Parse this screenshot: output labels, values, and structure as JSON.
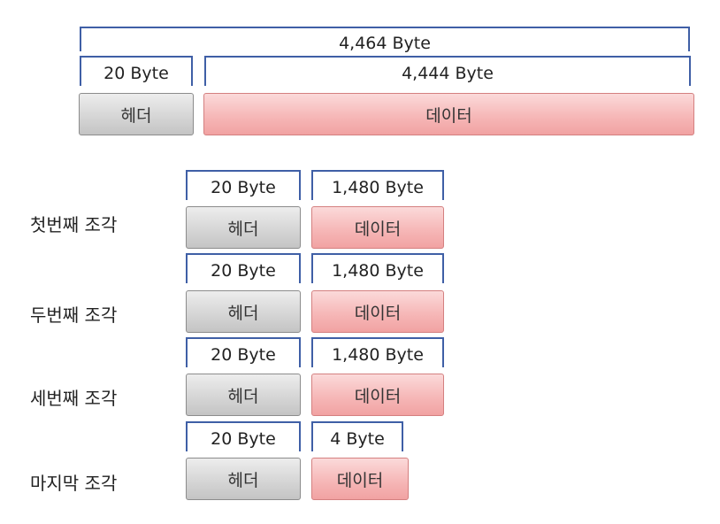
{
  "original": {
    "total_size": "4,464 Byte",
    "header_size": "20 Byte",
    "data_size": "4,444 Byte",
    "header_label": "헤더",
    "data_label": "데이터"
  },
  "fragments": [
    {
      "label": "첫번째 조각",
      "header_size": "20 Byte",
      "data_size": "1,480 Byte",
      "header_label": "헤더",
      "data_label": "데이터"
    },
    {
      "label": "두번째 조각",
      "header_size": "20 Byte",
      "data_size": "1,480 Byte",
      "header_label": "헤더",
      "data_label": "데이터"
    },
    {
      "label": "세번째 조각",
      "header_size": "20 Byte",
      "data_size": "1,480 Byte",
      "header_label": "헤더",
      "data_label": "데이터"
    },
    {
      "label": "마지막 조각",
      "header_size": "20 Byte",
      "data_size": "4 Byte",
      "header_label": "헤더",
      "data_label": "데이터"
    }
  ],
  "colors": {
    "bracket": "#3f5fa6",
    "header_fill": "#d6d6d6",
    "data_fill": "#f6b8b8"
  }
}
